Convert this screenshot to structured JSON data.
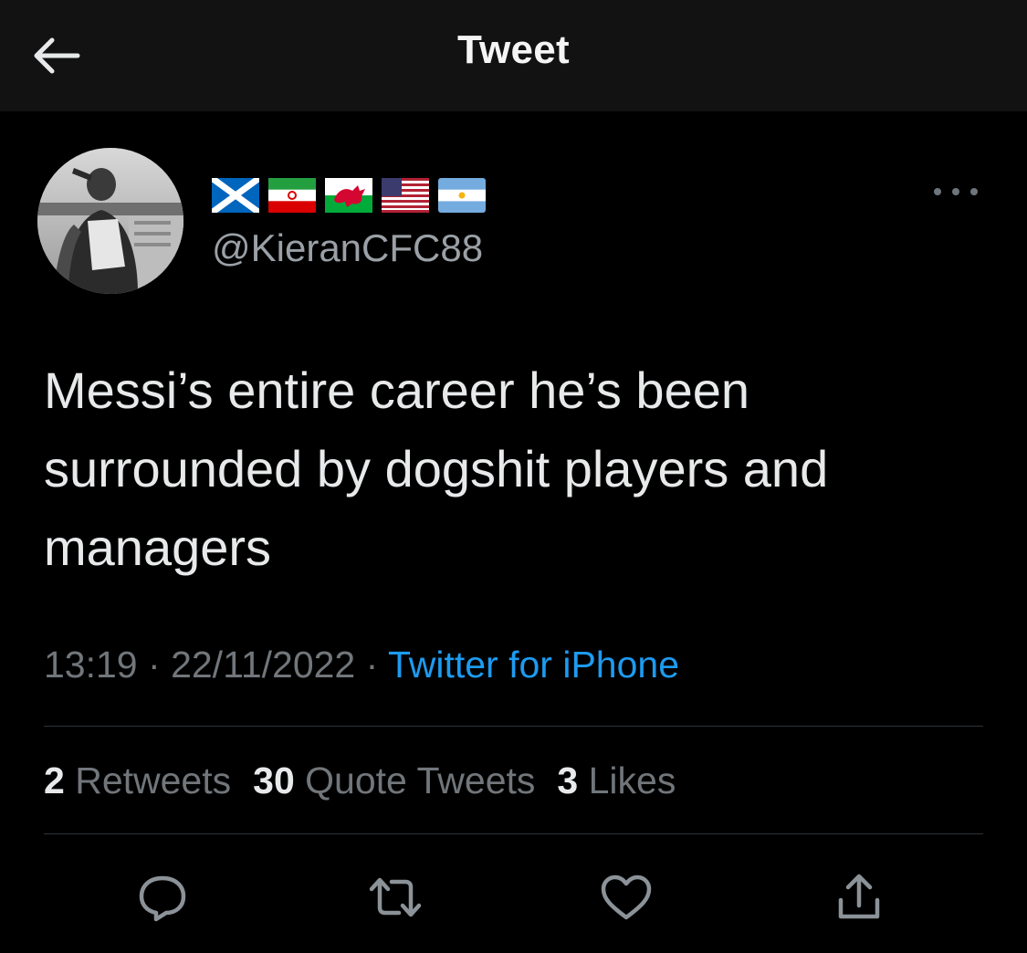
{
  "header": {
    "title": "Tweet",
    "back_icon": "arrow-left-icon"
  },
  "author": {
    "flags": [
      "scotland-flag",
      "iran-flag",
      "wales-flag",
      "usa-flag",
      "argentina-flag"
    ],
    "handle": "@KieranCFC88"
  },
  "tweet": {
    "text": "Messi’s entire career he’s been\nsurrounded by dogshit players and\nmanagers",
    "time": "13:19",
    "separator": "·",
    "date": "22/11/2022",
    "source": "Twitter for iPhone"
  },
  "stats": {
    "retweets_count": "2",
    "retweets_label": "Retweets",
    "quotes_count": "30",
    "quotes_label": "Quote Tweets",
    "likes_count": "3",
    "likes_label": "Likes"
  },
  "actions": [
    "reply-icon",
    "retweet-icon",
    "like-icon",
    "share-icon"
  ],
  "colors": {
    "background": "#000000",
    "header_background": "#121212",
    "text": "#e7e9ea",
    "muted": "#71767b",
    "link": "#1d9bf0",
    "divider": "#2f3336"
  }
}
